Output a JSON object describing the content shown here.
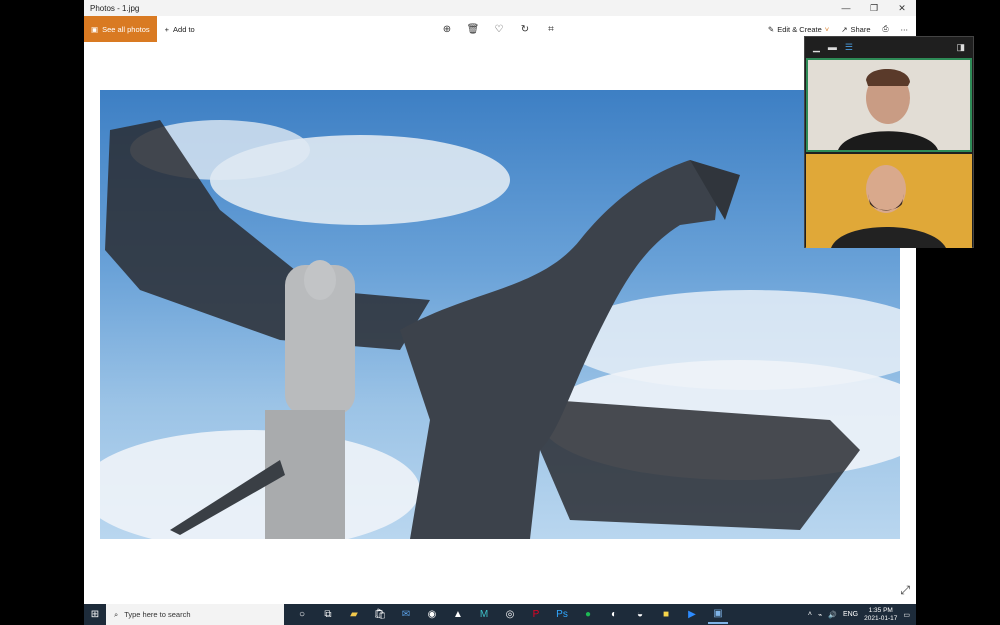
{
  "window": {
    "title": "Photos - 1.jpg"
  },
  "toolbar": {
    "see_all_label": "See all photos",
    "add_to_label": "Add to",
    "edit_create_label": "Edit & Create",
    "share_label": "Share",
    "center_icons": [
      "zoom-in-icon",
      "delete-icon",
      "heart-icon",
      "rotate-icon",
      "crop-icon"
    ]
  },
  "taskbar": {
    "search_placeholder": "Type here to search",
    "apps": [
      "task-view-icon",
      "file-explorer-icon",
      "store-icon",
      "mail-icon",
      "chrome-icon",
      "app-icon",
      "maya-icon",
      "app-icon",
      "pinterest-icon",
      "photoshop-icon",
      "spotify-icon",
      "app-icon",
      "app-icon",
      "sticky-notes-icon",
      "zoom-icon",
      "photos-icon"
    ],
    "language": "ENG",
    "time": "1:35 PM",
    "date": "2021-01-17"
  },
  "colors": {
    "accent": "#d97a22",
    "taskbar": "#1d2b3a",
    "active_speaker": "#2e8b57"
  }
}
